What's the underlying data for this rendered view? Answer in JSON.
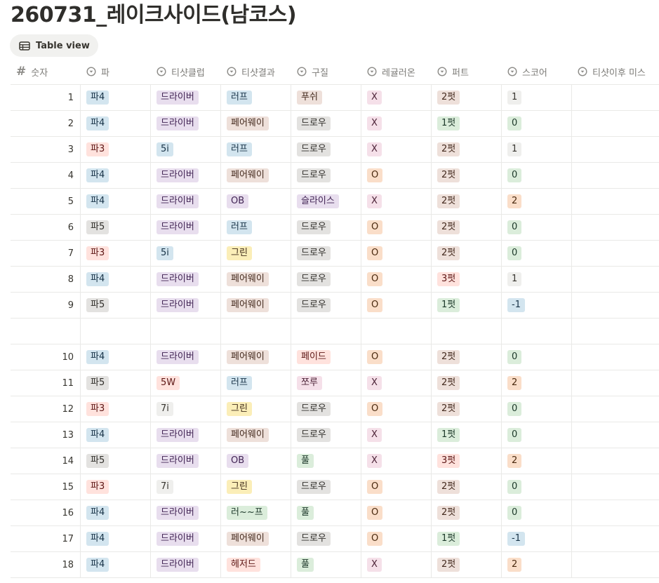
{
  "page": {
    "title": "260731_레이크사이드(남코스)"
  },
  "view_tab": {
    "label": "Table view",
    "icon": "table-icon"
  },
  "columns": [
    {
      "key": "num",
      "label": "숫자",
      "icon": "hash-icon"
    },
    {
      "key": "par",
      "label": "파",
      "icon": "select-icon"
    },
    {
      "key": "club",
      "label": "티샷클럽",
      "icon": "select-icon"
    },
    {
      "key": "result",
      "label": "티샷결과",
      "icon": "select-icon"
    },
    {
      "key": "ball",
      "label": "구질",
      "icon": "select-icon"
    },
    {
      "key": "reg",
      "label": "레귤러온",
      "icon": "select-icon"
    },
    {
      "key": "putt",
      "label": "퍼트",
      "icon": "select-icon"
    },
    {
      "key": "score",
      "label": "스코어",
      "icon": "select-icon"
    },
    {
      "key": "miss",
      "label": "티샷이후 미스",
      "icon": "select-icon"
    }
  ],
  "tag_colors": {
    "blue": "#d3e5ef",
    "purple": "#e8deee",
    "red": "#ffe2dd",
    "gray": "#e3e2e0",
    "default": "#efefed",
    "brown": "#eee0da",
    "orange": "#fadec9",
    "green": "#dbeddb",
    "pink": "#f5e0e9",
    "yellow": "#fbeeb8"
  },
  "rows": [
    {
      "num": "1",
      "par": [
        "파4",
        "blue"
      ],
      "club": [
        "드라이버",
        "purple"
      ],
      "result": [
        "러프",
        "blue"
      ],
      "ball": [
        "푸쉬",
        "brown"
      ],
      "reg": [
        "X",
        "pink"
      ],
      "putt": [
        "2펏",
        "brown"
      ],
      "score": [
        "1",
        "default"
      ]
    },
    {
      "num": "2",
      "par": [
        "파4",
        "blue"
      ],
      "club": [
        "드라이버",
        "purple"
      ],
      "result": [
        "페어웨이",
        "brown"
      ],
      "ball": [
        "드로우",
        "gray"
      ],
      "reg": [
        "X",
        "pink"
      ],
      "putt": [
        "1펏",
        "green"
      ],
      "score": [
        "0",
        "green"
      ]
    },
    {
      "num": "3",
      "par": [
        "파3",
        "red"
      ],
      "club": [
        "5i",
        "blue"
      ],
      "result": [
        "러프",
        "blue"
      ],
      "ball": [
        "드로우",
        "gray"
      ],
      "reg": [
        "X",
        "pink"
      ],
      "putt": [
        "2펏",
        "brown"
      ],
      "score": [
        "1",
        "default"
      ]
    },
    {
      "num": "4",
      "par": [
        "파4",
        "blue"
      ],
      "club": [
        "드라이버",
        "purple"
      ],
      "result": [
        "페어웨이",
        "brown"
      ],
      "ball": [
        "드로우",
        "gray"
      ],
      "reg": [
        "O",
        "orange"
      ],
      "putt": [
        "2펏",
        "brown"
      ],
      "score": [
        "0",
        "green"
      ]
    },
    {
      "num": "5",
      "par": [
        "파4",
        "blue"
      ],
      "club": [
        "드라이버",
        "purple"
      ],
      "result": [
        "OB",
        "purple"
      ],
      "ball": [
        "슬라이스",
        "purple"
      ],
      "reg": [
        "X",
        "pink"
      ],
      "putt": [
        "2펏",
        "brown"
      ],
      "score": [
        "2",
        "orange"
      ]
    },
    {
      "num": "6",
      "par": [
        "파5",
        "gray"
      ],
      "club": [
        "드라이버",
        "purple"
      ],
      "result": [
        "러프",
        "blue"
      ],
      "ball": [
        "드로우",
        "gray"
      ],
      "reg": [
        "O",
        "orange"
      ],
      "putt": [
        "2펏",
        "brown"
      ],
      "score": [
        "0",
        "green"
      ]
    },
    {
      "num": "7",
      "par": [
        "파3",
        "red"
      ],
      "club": [
        "5i",
        "blue"
      ],
      "result": [
        "그린",
        "yellow"
      ],
      "ball": [
        "드로우",
        "gray"
      ],
      "reg": [
        "O",
        "orange"
      ],
      "putt": [
        "2펏",
        "brown"
      ],
      "score": [
        "0",
        "green"
      ]
    },
    {
      "num": "8",
      "par": [
        "파4",
        "blue"
      ],
      "club": [
        "드라이버",
        "purple"
      ],
      "result": [
        "페어웨이",
        "brown"
      ],
      "ball": [
        "드로우",
        "gray"
      ],
      "reg": [
        "O",
        "orange"
      ],
      "putt": [
        "3펏",
        "red"
      ],
      "score": [
        "1",
        "default"
      ]
    },
    {
      "num": "9",
      "par": [
        "파5",
        "gray"
      ],
      "club": [
        "드라이버",
        "purple"
      ],
      "result": [
        "페어웨이",
        "brown"
      ],
      "ball": [
        "드로우",
        "gray"
      ],
      "reg": [
        "O",
        "orange"
      ],
      "putt": [
        "1펏",
        "green"
      ],
      "score": [
        "-1",
        "blue"
      ]
    },
    {
      "empty": true
    },
    {
      "num": "10",
      "par": [
        "파4",
        "blue"
      ],
      "club": [
        "드라이버",
        "purple"
      ],
      "result": [
        "페어웨이",
        "brown"
      ],
      "ball": [
        "페이드",
        "red"
      ],
      "reg": [
        "O",
        "orange"
      ],
      "putt": [
        "2펏",
        "brown"
      ],
      "score": [
        "0",
        "green"
      ]
    },
    {
      "num": "11",
      "par": [
        "파5",
        "gray"
      ],
      "club": [
        "5W",
        "red"
      ],
      "result": [
        "러프",
        "blue"
      ],
      "ball": [
        "쪼루",
        "pink"
      ],
      "reg": [
        "X",
        "pink"
      ],
      "putt": [
        "2펏",
        "brown"
      ],
      "score": [
        "2",
        "orange"
      ]
    },
    {
      "num": "12",
      "par": [
        "파3",
        "red"
      ],
      "club": [
        "7i",
        "default"
      ],
      "result": [
        "그린",
        "yellow"
      ],
      "ball": [
        "드로우",
        "gray"
      ],
      "reg": [
        "O",
        "orange"
      ],
      "putt": [
        "2펏",
        "brown"
      ],
      "score": [
        "0",
        "green"
      ]
    },
    {
      "num": "13",
      "par": [
        "파4",
        "blue"
      ],
      "club": [
        "드라이버",
        "purple"
      ],
      "result": [
        "페어웨이",
        "brown"
      ],
      "ball": [
        "드로우",
        "gray"
      ],
      "reg": [
        "X",
        "pink"
      ],
      "putt": [
        "1펏",
        "green"
      ],
      "score": [
        "0",
        "green"
      ]
    },
    {
      "num": "14",
      "par": [
        "파5",
        "gray"
      ],
      "club": [
        "드라이버",
        "purple"
      ],
      "result": [
        "OB",
        "purple"
      ],
      "ball": [
        "풀",
        "green"
      ],
      "reg": [
        "X",
        "pink"
      ],
      "putt": [
        "3펏",
        "red"
      ],
      "score": [
        "2",
        "orange"
      ]
    },
    {
      "num": "15",
      "par": [
        "파3",
        "red"
      ],
      "club": [
        "7i",
        "default"
      ],
      "result": [
        "그린",
        "yellow"
      ],
      "ball": [
        "드로우",
        "gray"
      ],
      "reg": [
        "O",
        "orange"
      ],
      "putt": [
        "2펏",
        "brown"
      ],
      "score": [
        "0",
        "green"
      ]
    },
    {
      "num": "16",
      "par": [
        "파4",
        "blue"
      ],
      "club": [
        "드라이버",
        "purple"
      ],
      "result": [
        "러~~프",
        "green"
      ],
      "ball": [
        "풀",
        "green"
      ],
      "reg": [
        "O",
        "orange"
      ],
      "putt": [
        "2펏",
        "brown"
      ],
      "score": [
        "0",
        "green"
      ]
    },
    {
      "num": "17",
      "par": [
        "파4",
        "blue"
      ],
      "club": [
        "드라이버",
        "purple"
      ],
      "result": [
        "페어웨이",
        "brown"
      ],
      "ball": [
        "드로우",
        "gray"
      ],
      "reg": [
        "O",
        "orange"
      ],
      "putt": [
        "1펏",
        "green"
      ],
      "score": [
        "-1",
        "blue"
      ]
    },
    {
      "num": "18",
      "par": [
        "파4",
        "blue"
      ],
      "club": [
        "드라이버",
        "purple"
      ],
      "result": [
        "헤저드",
        "red"
      ],
      "ball": [
        "풀",
        "green"
      ],
      "reg": [
        "X",
        "pink"
      ],
      "putt": [
        "2펏",
        "brown"
      ],
      "score": [
        "2",
        "orange"
      ]
    }
  ]
}
